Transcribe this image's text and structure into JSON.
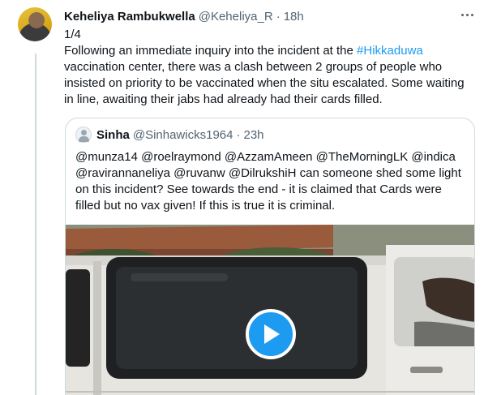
{
  "tweet": {
    "author_name": "Keheliya Rambukwella",
    "author_handle": "@Keheliya_R",
    "separator": "·",
    "timestamp": "18h",
    "thread_index": "1/4",
    "text_before_hashtag": "Following an immediate inquiry into the incident at the ",
    "hashtag": "#Hikkaduwa",
    "text_after_hashtag": " vaccination center, there was a clash between 2 groups of people who insisted on priority to be vaccinated when the situ escalated. Some waiting in line, awaiting their jabs had already had their cards filled.",
    "more_icon": "more-horizontal-icon"
  },
  "quoted_tweet": {
    "author_name": "Sinha",
    "author_handle": "@Sinhawicks1964",
    "separator": "·",
    "timestamp": "23h",
    "text": "@munza14 @roelraymond @AzzamAmeen @TheMorningLK @indica @ravirannaneliya @ruvanw @DilrukshiH  can someone shed some light on this incident? See towards the end - it is claimed that Cards were filled but no vax given! If this is true it is criminal.",
    "media": {
      "type": "video",
      "play_icon": "play-icon"
    }
  },
  "colors": {
    "accent": "#1d9bf0",
    "text": "#0f1419",
    "secondary": "#536471",
    "border": "#cfd9de"
  }
}
